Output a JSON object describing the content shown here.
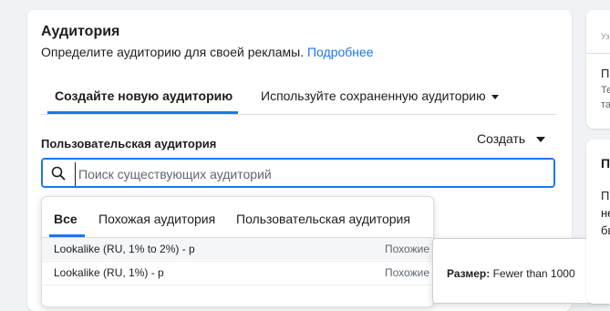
{
  "audience": {
    "title": "Аудитория",
    "subtitle": "Определите аудиторию для своей рекламы.",
    "more_link": "Подробнее"
  },
  "tabs": {
    "create_new": "Создайте новую аудиторию",
    "use_saved": "Используйте сохраненную аудиторию"
  },
  "custom_audience": {
    "label": "Пользовательская аудитория",
    "create_button": "Создать"
  },
  "search": {
    "placeholder": "Поиск существующих аудиторий",
    "value": ""
  },
  "dropdown": {
    "tabs": [
      "Все",
      "Похожая аудитория",
      "Пользовательская аудитория"
    ],
    "rows": [
      {
        "name": "Lookalike (RU, 1% to 2%) - p",
        "type": "Похожие"
      },
      {
        "name": "Lookalike (RU, 1%) - p",
        "type": "Похожие"
      },
      {
        "name": "",
        "type": ""
      }
    ]
  },
  "tooltip": {
    "size_label": "Размер:",
    "size_value": "Fewer than 1000"
  },
  "right_panel": {
    "p1_line1": "Уз",
    "p1_line2": "П",
    "p1_line3": "Те",
    "p1_line4": "та",
    "p2_line1": "П",
    "p2_line2": "П",
    "p2_line3": "не",
    "p2_line4": "бы"
  },
  "colors": {
    "accent": "#1877f2",
    "background": "#f0f2f5"
  }
}
